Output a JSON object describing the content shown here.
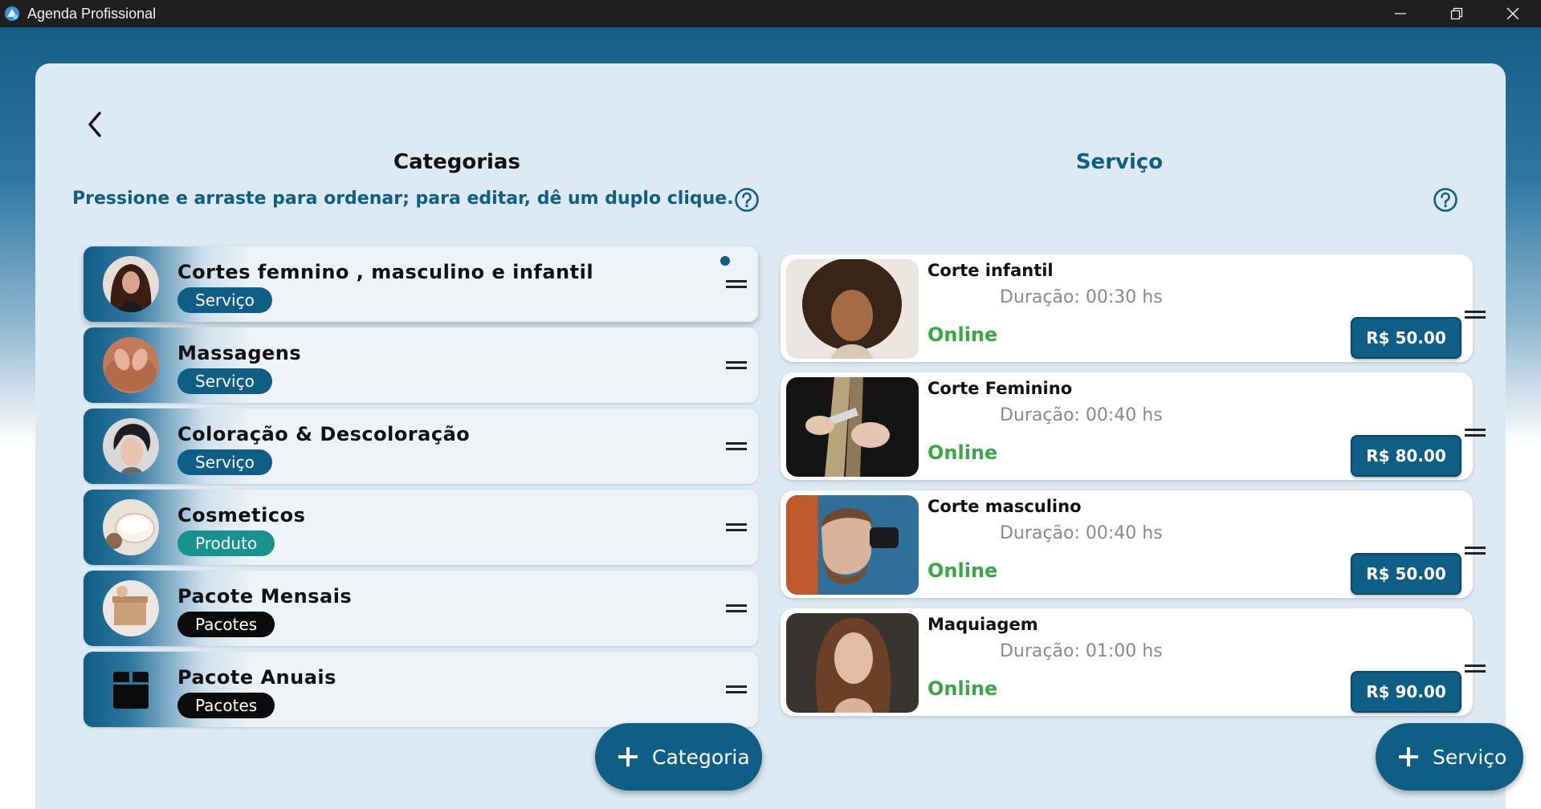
{
  "window": {
    "title": "Agenda Profissional"
  },
  "header": {
    "categories_title": "Categorias",
    "services_title": "Serviço",
    "hint": "Pressione e arraste para ordenar; para editar, dê um duplo clique."
  },
  "categories": [
    {
      "name": "Cortes femnino , masculino e infantil",
      "badge": "Serviço",
      "badge_type": "servico",
      "selected": true,
      "thumb": "woman-long-hair"
    },
    {
      "name": "Massagens",
      "badge": "Serviço",
      "badge_type": "servico",
      "selected": false,
      "thumb": "massage"
    },
    {
      "name": "Coloração & Descoloração",
      "badge": "Serviço",
      "badge_type": "servico",
      "selected": false,
      "thumb": "short-hair-woman"
    },
    {
      "name": "Cosmeticos",
      "badge": "Produto",
      "badge_type": "produto",
      "selected": false,
      "thumb": "cream-jar"
    },
    {
      "name": "Pacote Mensais",
      "badge": "Pacotes",
      "badge_type": "pacotes",
      "selected": false,
      "thumb": "gift-box"
    },
    {
      "name": "Pacote Anuais",
      "badge": "Pacotes",
      "badge_type": "pacotes",
      "selected": false,
      "thumb": "box-icon"
    }
  ],
  "services": [
    {
      "name": "Corte infantil",
      "duration": "Duração: 00:30 hs",
      "status": "Online",
      "price": "R$ 50.00",
      "thumb": "child-curly-hair"
    },
    {
      "name": "Corte Feminino",
      "duration": "Duração: 00:40 hs",
      "status": "Online",
      "price": "R$ 80.00",
      "thumb": "scissors-comb"
    },
    {
      "name": "Corte masculino",
      "duration": "Duração: 00:40 hs",
      "status": "Online",
      "price": "R$ 50.00",
      "thumb": "man-beard-clipper"
    },
    {
      "name": "Maquiagem",
      "duration": "Duração: 01:00 hs",
      "status": "Online",
      "price": "R$ 90.00",
      "thumb": "woman-portrait"
    }
  ],
  "actions": {
    "add_category": "Categoria",
    "add_service": "Serviço"
  },
  "colors": {
    "primary": "#0f5e86",
    "online": "#3aa745",
    "produto": "#17928f",
    "pacotes": "#0b0b0b"
  }
}
